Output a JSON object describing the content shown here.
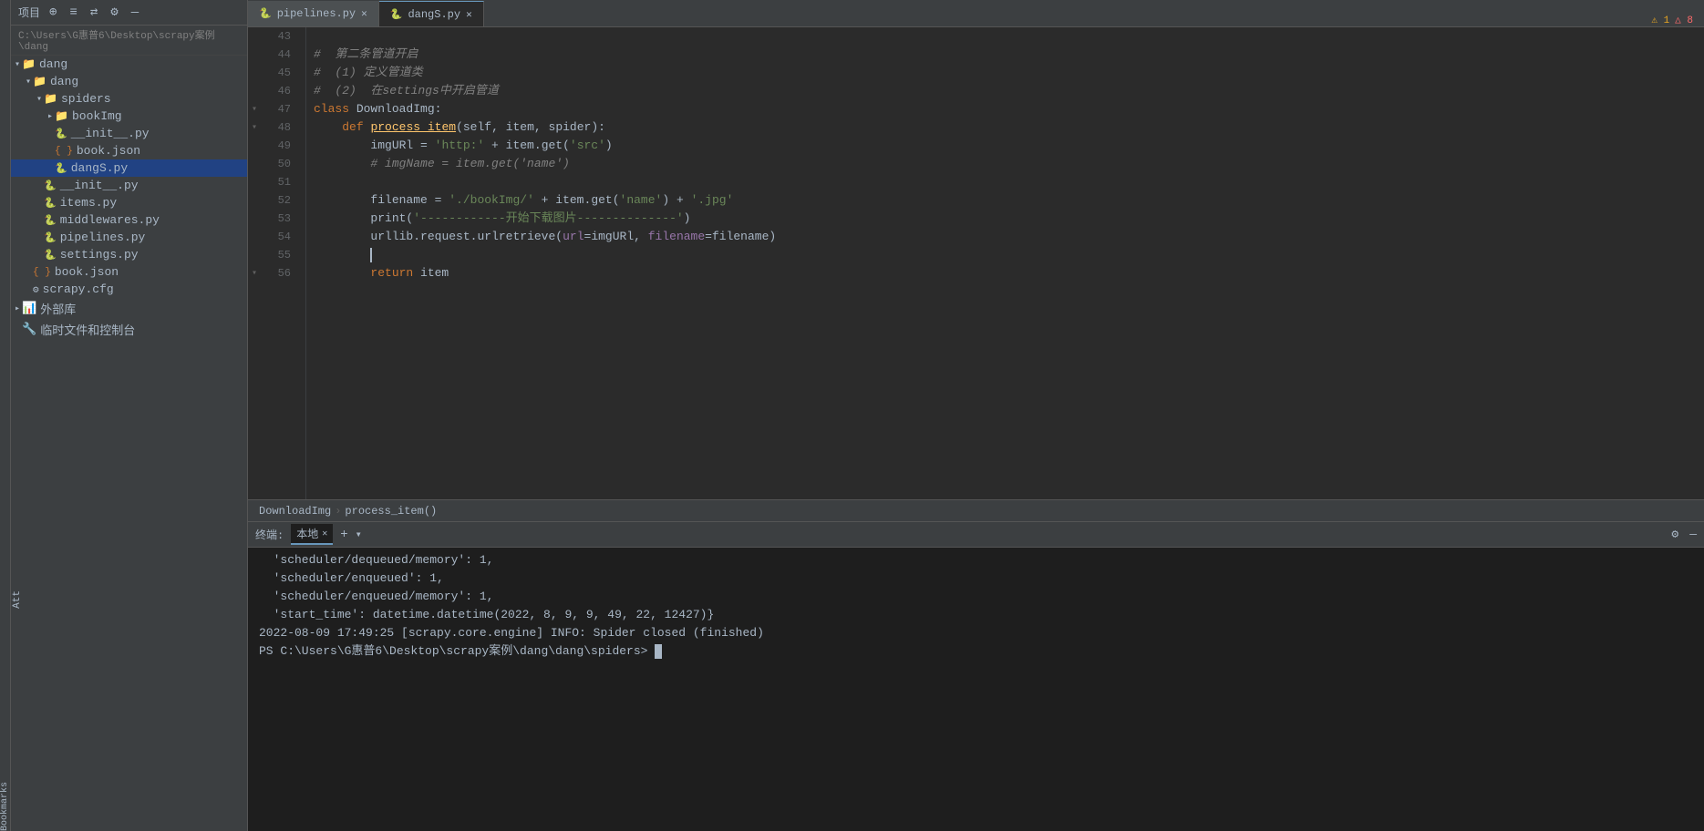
{
  "toolbar": {
    "project_label": "项目",
    "icons": [
      "⊕",
      "≡",
      "⇄",
      "⚙",
      "—"
    ]
  },
  "sidebar": {
    "root": {
      "name": "dang",
      "path": "C:\\Users\\G惠普6\\Desktop\\scrapy案例\\dang"
    },
    "tree": [
      {
        "level": 0,
        "type": "folder",
        "name": "dang",
        "expanded": true,
        "arrow": "▾"
      },
      {
        "level": 1,
        "type": "folder",
        "name": "dang",
        "expanded": true,
        "arrow": "▾"
      },
      {
        "level": 2,
        "type": "folder",
        "name": "spiders",
        "expanded": true,
        "arrow": "▾"
      },
      {
        "level": 3,
        "type": "folder",
        "name": "bookImg",
        "expanded": false,
        "arrow": "▸"
      },
      {
        "level": 3,
        "type": "py",
        "name": "__init__.py"
      },
      {
        "level": 3,
        "type": "json",
        "name": "book.json"
      },
      {
        "level": 3,
        "type": "py",
        "name": "dangS.py",
        "selected": true
      },
      {
        "level": 2,
        "type": "py",
        "name": "__init__.py"
      },
      {
        "level": 2,
        "type": "py",
        "name": "items.py"
      },
      {
        "level": 2,
        "type": "py",
        "name": "middlewares.py"
      },
      {
        "level": 2,
        "type": "py",
        "name": "pipelines.py"
      },
      {
        "level": 2,
        "type": "py",
        "name": "settings.py"
      },
      {
        "level": 1,
        "type": "json",
        "name": "book.json"
      },
      {
        "level": 1,
        "type": "cfg",
        "name": "scrapy.cfg"
      },
      {
        "level": 0,
        "type": "ext_lib",
        "name": "外部库",
        "arrow": "▸"
      },
      {
        "level": 0,
        "type": "special",
        "name": "临时文件和控制台"
      }
    ]
  },
  "tabs": [
    {
      "label": "pipelines.py",
      "active": false,
      "icon": "🐍"
    },
    {
      "label": "dangS.py",
      "active": true,
      "icon": "🐍"
    }
  ],
  "editor": {
    "lines": [
      {
        "num": 43,
        "content": ""
      },
      {
        "num": 44,
        "content": "#  第二条管道开启",
        "type": "comment"
      },
      {
        "num": 45,
        "content": "#  (1) 定义管道类",
        "type": "comment"
      },
      {
        "num": 46,
        "content": "#  (2)  在settings中开启管道",
        "type": "comment"
      },
      {
        "num": 47,
        "content": "class DownloadImg:",
        "type": "class"
      },
      {
        "num": 48,
        "content": "    def process_item(self, item, spider):",
        "type": "def"
      },
      {
        "num": 49,
        "content": "        imgURl = 'http:' + item.get('src')",
        "type": "code"
      },
      {
        "num": 50,
        "content": "        # imgName = item.get('name')",
        "type": "comment"
      },
      {
        "num": 51,
        "content": "",
        "type": "blank"
      },
      {
        "num": 52,
        "content": "        filename = './bookImg/' + item.get('name') + '.jpg'",
        "type": "code"
      },
      {
        "num": 53,
        "content": "        print('------------开始下载图片--------------')",
        "type": "code"
      },
      {
        "num": 54,
        "content": "        urllib.request.urlretrieve(url=imgURl, filename=filename)",
        "type": "code"
      },
      {
        "num": 55,
        "content": "",
        "type": "blank"
      },
      {
        "num": 56,
        "content": "        return item",
        "type": "code"
      }
    ],
    "breadcrumb": {
      "class_name": "DownloadImg",
      "method_name": "process_item()"
    },
    "warnings": {
      "warning_count": 1,
      "error_count": 8
    }
  },
  "terminal": {
    "tab_label": "本地",
    "lines": [
      "  'scheduler/dequeued/memory': 1,",
      "  'scheduler/enqueued': 1,",
      "  'scheduler/enqueued/memory': 1,",
      "  'start_time': datetime.datetime(2022, 8, 9, 9, 49, 22, 12427)}",
      "2022-08-09 17:49:25 [scrapy.core.engine] INFO: Spider closed (finished)",
      "PS C:\\Users\\G惠普6\\Desktop\\scrapy案例\\dang\\dang\\spiders> "
    ],
    "prompt": "PS C:\\Users\\G惠普6\\Desktop\\scrapy案例\\dang\\dang\\spiders> "
  },
  "bookmarks_label": "Bookmarks",
  "att_label": "Att"
}
